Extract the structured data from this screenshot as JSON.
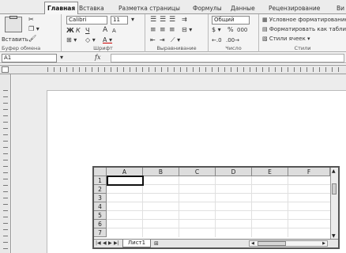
{
  "ribbon_tabs": [
    "Главная",
    "Вставка",
    "Разметка страницы",
    "Формулы",
    "Данные",
    "Рецензирование",
    "Ви"
  ],
  "clipboard": {
    "paste_label": "Вставить",
    "group_label": "Буфер обмена"
  },
  "font": {
    "name": "Calibri",
    "size": "11",
    "group_label": "Шрифт",
    "bold": "Ж",
    "italic": "К",
    "underline": "Ч",
    "grow": "A",
    "shrink": "A"
  },
  "alignment": {
    "group_label": "Выравнивание"
  },
  "number": {
    "format": "Общий",
    "percent": "%",
    "thousands": "000",
    "group_label": "Число"
  },
  "styles": {
    "conditional": "Условное форматирование",
    "as_table": "Форматировать как таблицу",
    "cell_styles": "Стили ячеек",
    "group_label": "Стили"
  },
  "formula_bar": {
    "name_box": "A1",
    "fx": "fx"
  },
  "sheet": {
    "columns": [
      "A",
      "B",
      "C",
      "D",
      "E",
      "F"
    ],
    "rows": [
      "1",
      "2",
      "3",
      "4",
      "5",
      "6",
      "7"
    ],
    "selected_cell": "A1",
    "tab_name": "Лист1"
  }
}
